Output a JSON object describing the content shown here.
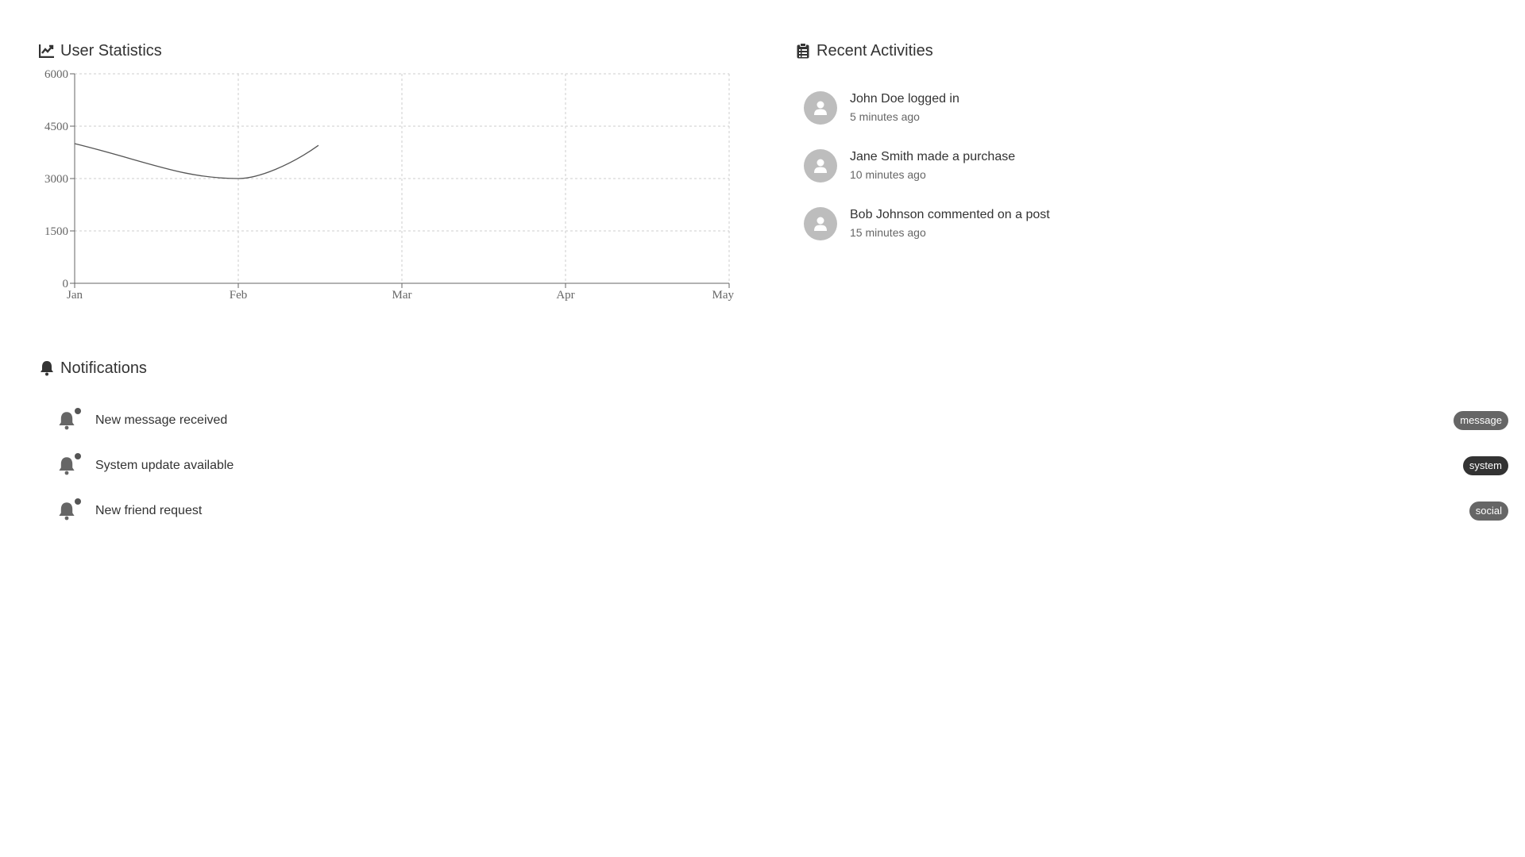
{
  "stats": {
    "title": "User Statistics",
    "icon": "chart-line-icon"
  },
  "chart_data": {
    "type": "line",
    "categories": [
      "Jan",
      "Feb",
      "Mar",
      "Apr",
      "May"
    ],
    "series": [
      {
        "values": [
          4000,
          3000,
          3950
        ]
      }
    ],
    "y_ticks": [
      "0",
      "1500",
      "3000",
      "4500",
      "6000"
    ],
    "ylim": [
      0,
      6000
    ],
    "grid": true,
    "line_color": "#555555",
    "grid_color": "#cccccc"
  },
  "activities": {
    "title": "Recent Activities",
    "icon": "clipboard-list-icon",
    "items": [
      {
        "title": "John Doe logged in",
        "time": "5 minutes ago",
        "icon": "user-icon"
      },
      {
        "title": "Jane Smith made a purchase",
        "time": "10 minutes ago",
        "icon": "user-icon"
      },
      {
        "title": "Bob Johnson commented on a post",
        "time": "15 minutes ago",
        "icon": "user-icon"
      }
    ]
  },
  "notifications": {
    "title": "Notifications",
    "icon": "bell-icon",
    "items": [
      {
        "text": "New message received",
        "badge": "message",
        "badge_color": "#666666"
      },
      {
        "text": "System update available",
        "badge": "system",
        "badge_color": "#333333"
      },
      {
        "text": "New friend request",
        "badge": "social",
        "badge_color": "#666666"
      }
    ]
  }
}
